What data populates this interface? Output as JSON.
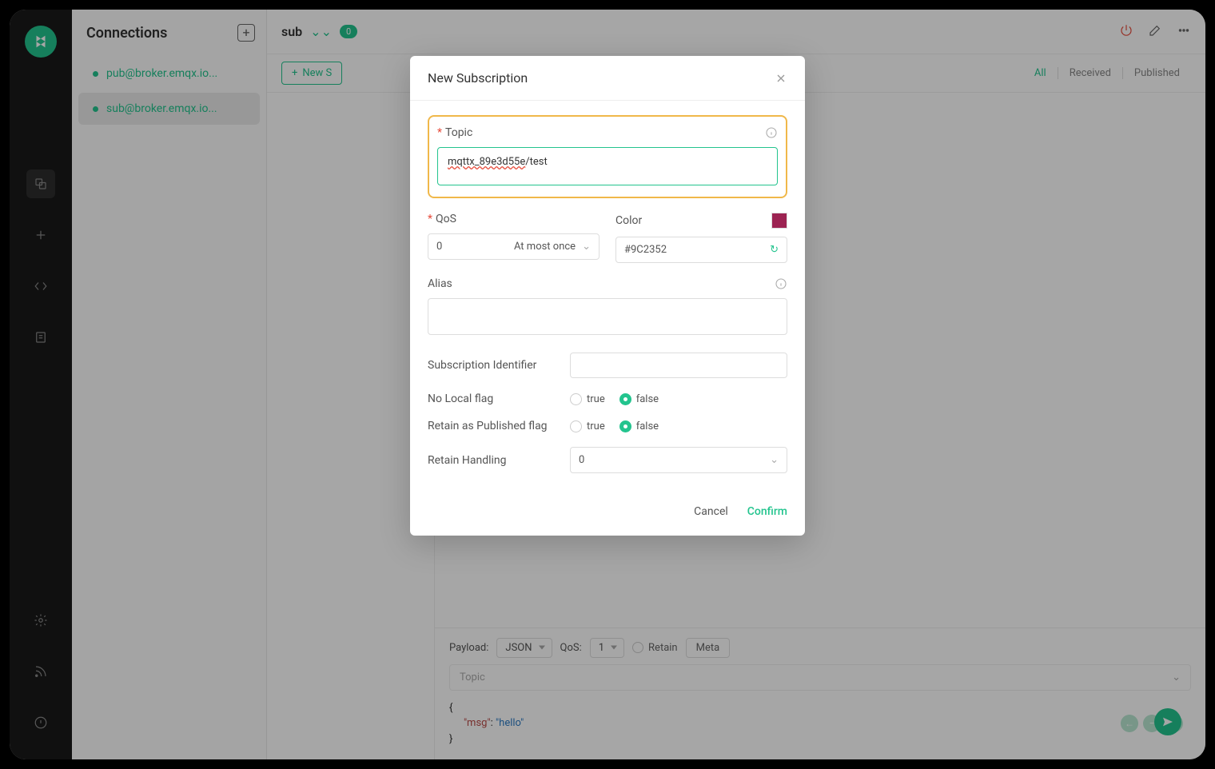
{
  "sidebar": {
    "title": "Connections",
    "items": [
      {
        "name": "pub@broker.emqx.io..."
      },
      {
        "name": "sub@broker.emqx.io..."
      }
    ]
  },
  "topbar": {
    "title": "sub",
    "badge": "0"
  },
  "subbar": {
    "new_label": "New S",
    "filters": {
      "all": "All",
      "received": "Received",
      "published": "Published"
    }
  },
  "publish": {
    "payload_label": "Payload:",
    "payload_format": "JSON",
    "qos_label": "QoS:",
    "qos_value": "1",
    "retain_label": "Retain",
    "meta_label": "Meta",
    "topic_placeholder": "Topic",
    "code": {
      "open": "{",
      "key": "\"msg\"",
      "colon": ": ",
      "val": "\"hello\"",
      "close": "}"
    }
  },
  "dialog": {
    "title": "New Subscription",
    "topic_label": "Topic",
    "topic_value": "mqttx_89e3d55e/test",
    "topic_prefix": "mqttx_89e3d55e",
    "topic_suffix": "/test",
    "qos_label": "QoS",
    "qos_value": "0",
    "qos_text": "At most once",
    "color_label": "Color",
    "color_value": "#9C2352",
    "alias_label": "Alias",
    "sub_id_label": "Subscription Identifier",
    "no_local_label": "No Local flag",
    "retain_pub_label": "Retain as Published flag",
    "retain_handling_label": "Retain Handling",
    "retain_handling_value": "0",
    "true_label": "true",
    "false_label": "false",
    "cancel": "Cancel",
    "confirm": "Confirm"
  }
}
